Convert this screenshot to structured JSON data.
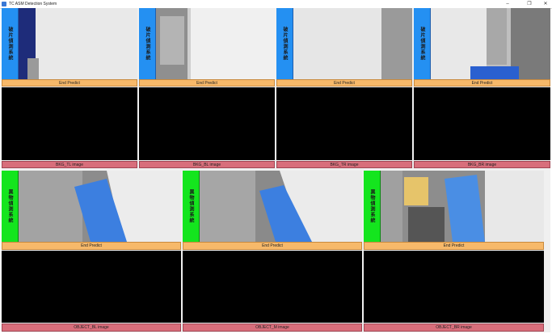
{
  "window": {
    "title": "TC ASM Detection System",
    "controls": {
      "minimize": "–",
      "maximize": "❐",
      "close": "✕"
    }
  },
  "top_row": {
    "side_label": "破片偵測系統",
    "predict_label": "End Predict",
    "image_labels": [
      "BKG_TL image",
      "BKG_BL image",
      "BKG_TR image",
      "BKG_BR image"
    ]
  },
  "bottom_row": {
    "side_label": "異物偵測系統",
    "predict_label": "End Predict",
    "image_labels": [
      "OBJECT_BL image",
      "OBJECT_M image",
      "OBJECT_BR image"
    ]
  },
  "colors": {
    "side_blue": "#2490f2",
    "side_green": "#14e51e",
    "predict_bar": "#f7b96a",
    "image_bar": "#d86e7b"
  },
  "icons": {
    "app": "app-icon"
  }
}
